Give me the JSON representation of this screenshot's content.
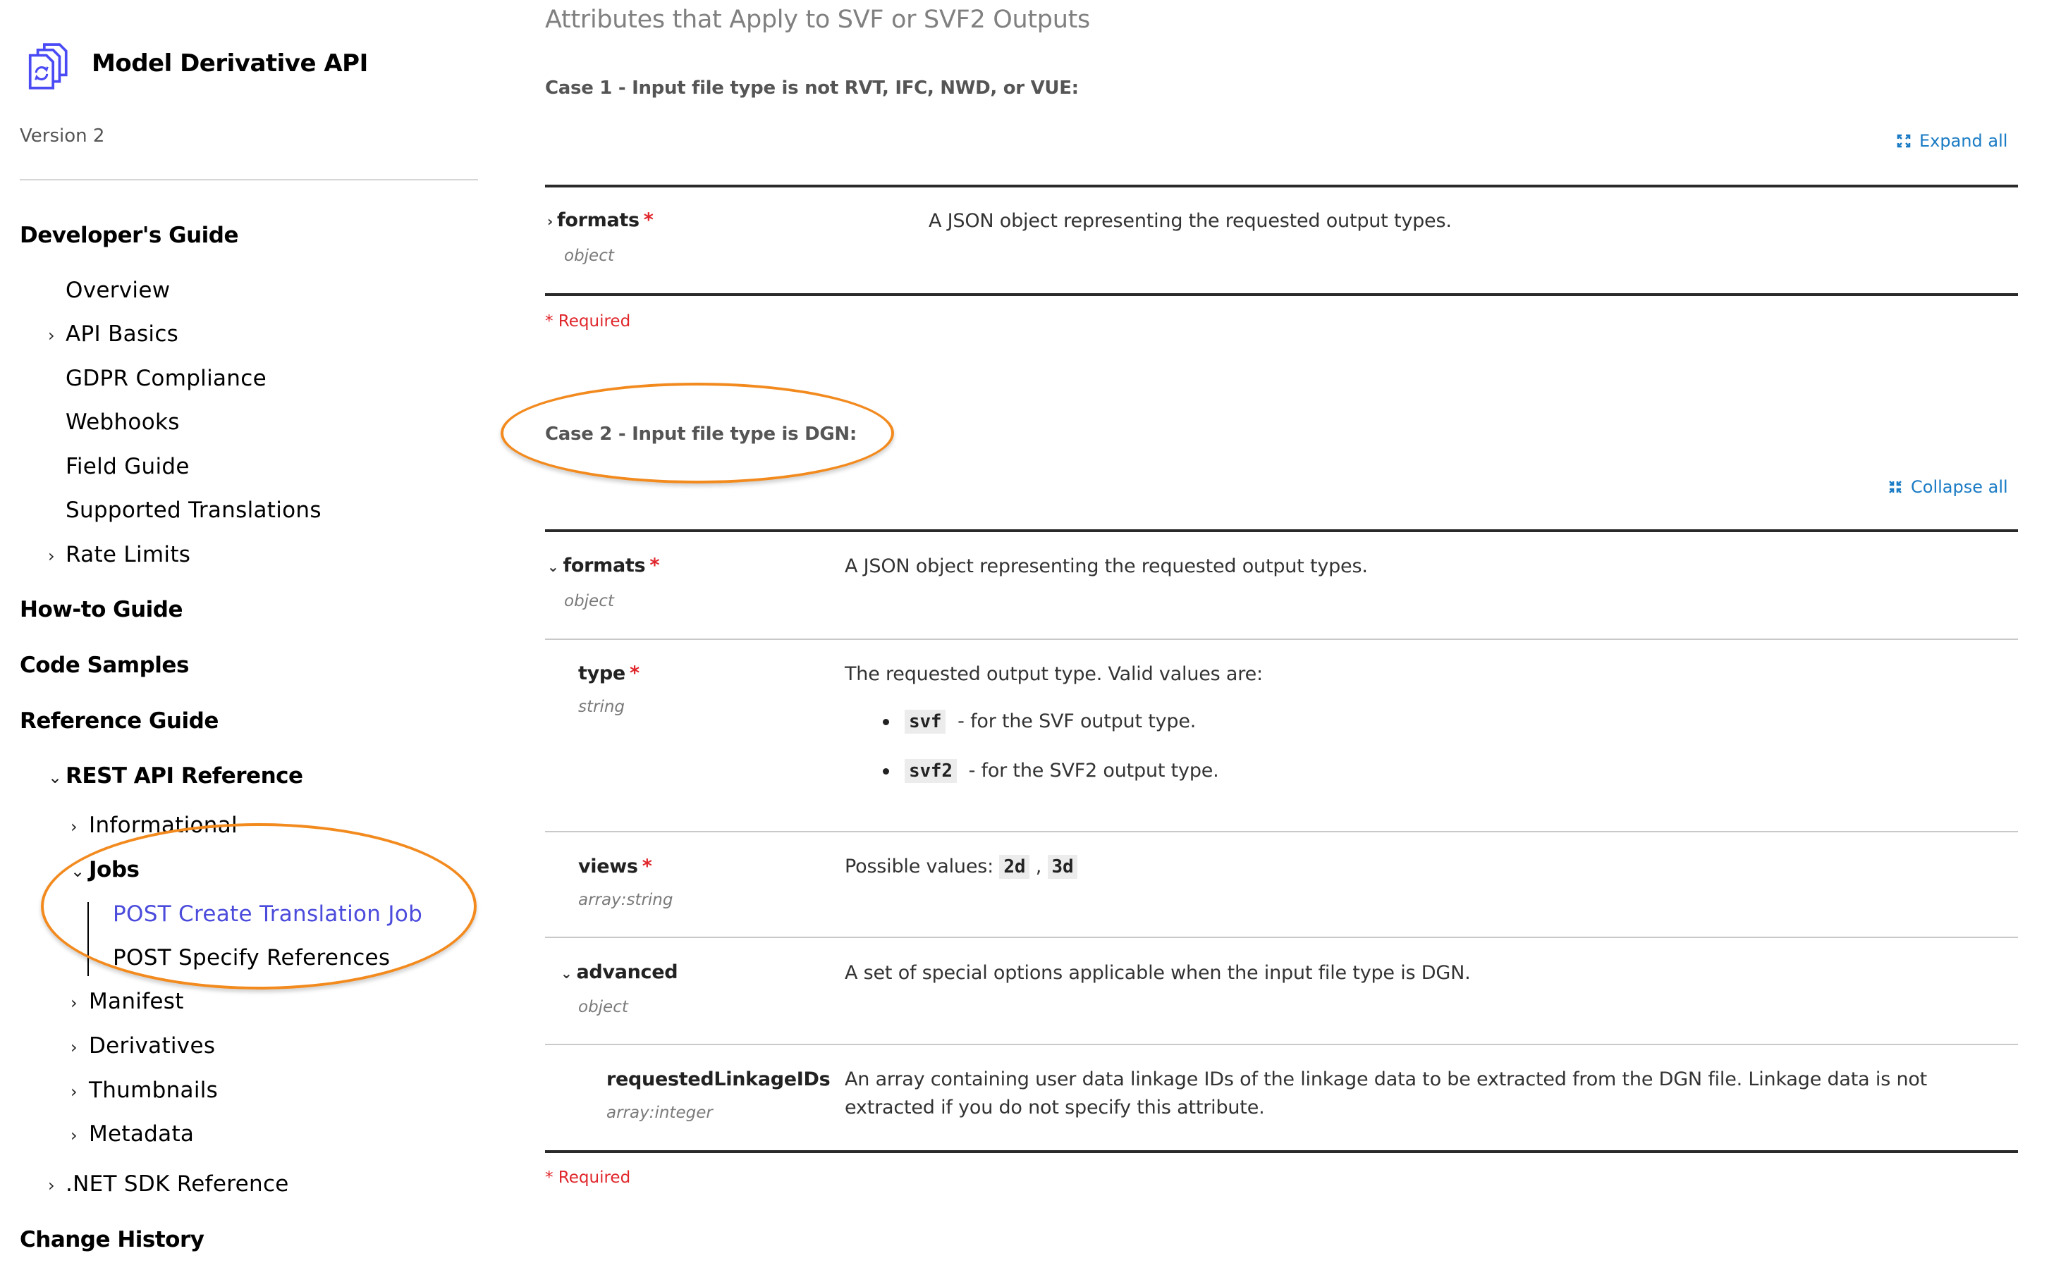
{
  "sidebar": {
    "app_title": "Model Derivative API",
    "icon": "document-stack-sync-icon",
    "version": "Version 2",
    "sections": {
      "developers_guide": "Developer's Guide",
      "developers_guide_items": [
        "Overview",
        "API Basics",
        "GDPR Compliance",
        "Webhooks",
        "Field Guide",
        "Supported Translations",
        "Rate Limits"
      ],
      "how_to_guide": "How-to Guide",
      "code_samples": "Code Samples",
      "reference_guide": "Reference Guide",
      "rest_api_reference": "REST API Reference",
      "rest_items": [
        "Informational",
        "Jobs",
        "Manifest",
        "Derivatives",
        "Thumbnails",
        "Metadata"
      ],
      "jobs_children": [
        "POST Create Translation Job",
        "POST Specify References"
      ],
      "active_item": "POST Create Translation Job",
      "net_sdk_reference": ".NET SDK Reference",
      "change_history": "Change History"
    },
    "active_color": "#4b4bdc"
  },
  "main": {
    "title": "Attributes that Apply to SVF or SVF2 Outputs",
    "case1": {
      "heading": "Case 1 - Input file type is not RVT, IFC, NWD, or VUE:",
      "toggle_label": "Expand all",
      "toggle_icon": "expand-icon",
      "rows": [
        {
          "name": "formats",
          "required": "*",
          "type": "object",
          "desc": "A JSON object representing the requested output types.",
          "state": "collapsed"
        }
      ],
      "required_note": "* Required"
    },
    "case2": {
      "heading": "Case 2 - Input file type is DGN:",
      "toggle_label": "Collapse all",
      "toggle_icon": "collapse-icon",
      "rows": [
        {
          "name": "formats",
          "required": "*",
          "type": "object",
          "desc": "A JSON object representing the requested output types.",
          "state": "expanded"
        },
        {
          "name": "type",
          "required": "*",
          "type": "string",
          "desc": "The requested output type. Valid values are:",
          "values": [
            {
              "code": "svf",
              "text": "- for the SVF output type."
            },
            {
              "code": "svf2",
              "text": "- for the SVF2 output type."
            }
          ]
        },
        {
          "name": "views",
          "required": "*",
          "type": "array:string",
          "desc": "Possible values:",
          "codes": [
            "2d",
            "3d"
          ],
          "sep": ","
        },
        {
          "name": "advanced",
          "required": "",
          "type": "object",
          "desc": "A set of special options applicable when the input file type is DGN.",
          "state": "expanded"
        },
        {
          "name": "requestedLinkageIDs",
          "required": "",
          "type": "array:integer",
          "desc_line1": "An array containing user data linkage IDs of the linkage data to be extracted from the DGN file. Linkage data is not",
          "desc_line2": "extracted if you do not specify this attribute."
        }
      ],
      "required_note": "* Required"
    }
  },
  "colors": {
    "accent_link": "#1a7bc4",
    "required": "#e0262b",
    "annotation": "#f28a1e"
  },
  "glyphs": {
    "chevron_right": "›",
    "chevron_down": "⌄"
  }
}
